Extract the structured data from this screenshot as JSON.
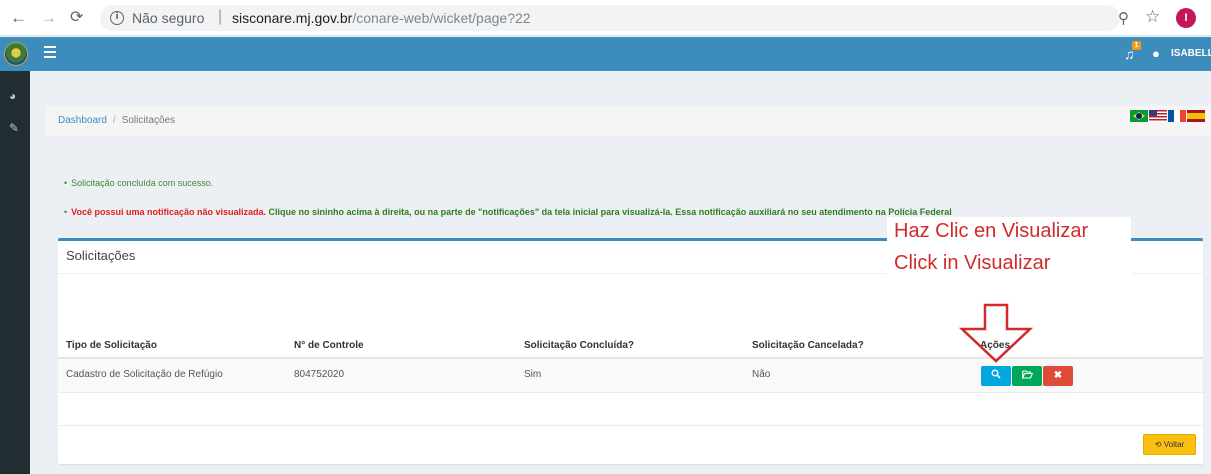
{
  "browser": {
    "security_label": "Não seguro",
    "url_host": "sisconare.mj.gov.br",
    "url_path": "/conare-web/wicket/page?22",
    "profile_initial": "I"
  },
  "header": {
    "notification_count": "1",
    "user_name": "ISABELL"
  },
  "breadcrumb": {
    "home": "Dashboard",
    "separator": "/",
    "current": "Solicitações"
  },
  "messages": {
    "success": "Solicitação concluída com sucesso.",
    "warning_red": "Você possui uma notificação não visualizada.",
    "warning_green": " Clique no sininho acima à direita, ou na parte de \"notificações\" da tela inicial para visualizá-la. Essa notificação auxiliará no seu atendimento na Polícia Federal"
  },
  "box": {
    "title": "Solicitações"
  },
  "table": {
    "headers": [
      "Tipo de Solicitação",
      "N° de Controle",
      "Solicitação Concluída?",
      "Solicitação Cancelada?",
      "Ações"
    ],
    "rows": [
      [
        "Cadastro de Solicitação de Refúgio",
        "804752020",
        "Sim",
        "Não"
      ]
    ]
  },
  "buttons": {
    "back_label": "Voltar"
  },
  "annotation": {
    "line1": "Haz Clic en Visualizar",
    "line2": "Click in Visualizar",
    "color": "#d22a2a"
  },
  "colors": {
    "topbar": "#3c8dbc",
    "sidebar": "#222d32",
    "view_button": "#00a7e0",
    "folder_button": "#00a65a",
    "cancel_button": "#dd4b39",
    "back_button": "#f9bf11"
  }
}
